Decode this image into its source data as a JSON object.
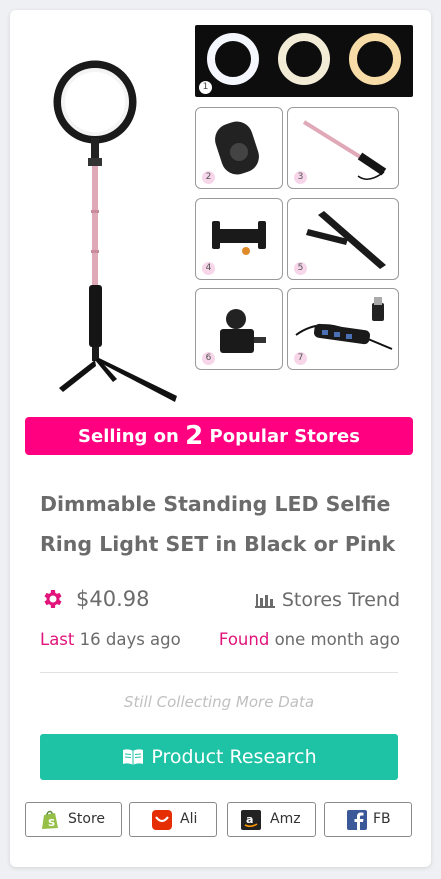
{
  "product": {
    "thumb_numbers": [
      "1",
      "2",
      "3",
      "4",
      "5",
      "6",
      "7"
    ],
    "banner": {
      "prefix": "Selling on",
      "count": "2",
      "suffix": "Popular Stores"
    },
    "title": "Dimmable Standing LED Selfie Ring Light SET in Black or Pink",
    "price": "$40.98",
    "stores_trend": "Stores Trend",
    "last_label": "Last",
    "last_value": "16 days ago",
    "found_label": "Found",
    "found_value": "one month ago",
    "collecting": "Still Collecting More Data",
    "research_button": "Product Research"
  },
  "stores": [
    {
      "label": "Store",
      "icon": "shopify-icon"
    },
    {
      "label": "Ali",
      "icon": "aliexpress-icon"
    },
    {
      "label": "Amz",
      "icon": "amazon-icon"
    },
    {
      "label": "FB",
      "icon": "facebook-icon"
    }
  ],
  "colors": {
    "accent_pink": "#ff0080",
    "label_pink": "#e0147a",
    "teal": "#1ec3a6",
    "text_gray": "#6b6b6b"
  }
}
